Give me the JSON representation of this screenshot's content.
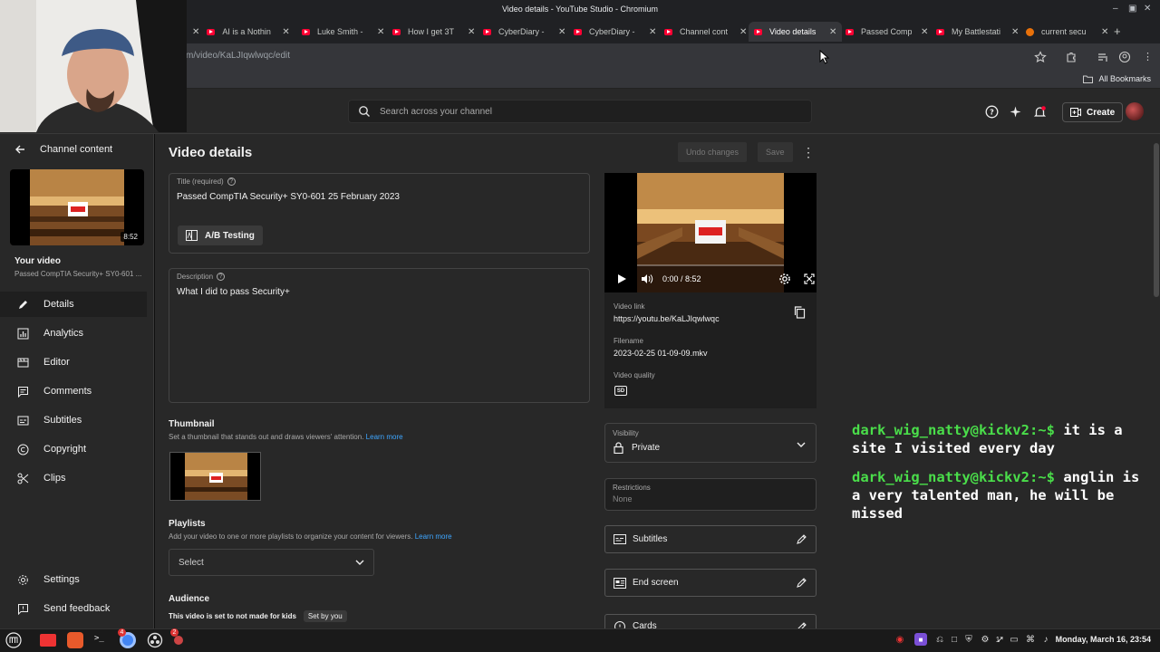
{
  "window": {
    "title": "Video details - YouTube Studio - Chromium",
    "tabs": [
      {
        "label": "AI is a Nothin"
      },
      {
        "label": "Luke Smith -"
      },
      {
        "label": "How I get 3T"
      },
      {
        "label": "CyberDiary -"
      },
      {
        "label": "CyberDiary -"
      },
      {
        "label": "Channel cont"
      },
      {
        "label": "Video details"
      },
      {
        "label": "Passed Comp"
      },
      {
        "label": "My Battlestati"
      },
      {
        "label": "current secu"
      }
    ],
    "url": "m/video/KaLJIqwlwqc/edit",
    "all_bookmarks": "All Bookmarks"
  },
  "header": {
    "search_placeholder": "Search across your channel",
    "create_label": "Create"
  },
  "sidebar": {
    "back_label": "Channel content",
    "thumb_duration": "8:52",
    "your_video": "Your video",
    "your_video_title": "Passed CompTIA Security+ SY0-601 ...",
    "items": [
      {
        "label": "Details",
        "icon": "pencil-icon"
      },
      {
        "label": "Analytics",
        "icon": "analytics-icon"
      },
      {
        "label": "Editor",
        "icon": "editor-icon"
      },
      {
        "label": "Comments",
        "icon": "comments-icon"
      },
      {
        "label": "Subtitles",
        "icon": "subtitles-icon"
      },
      {
        "label": "Copyright",
        "icon": "copyright-icon"
      },
      {
        "label": "Clips",
        "icon": "clips-icon"
      }
    ],
    "settings": "Settings",
    "feedback": "Send feedback"
  },
  "main": {
    "page_title": "Video details",
    "undo_label": "Undo changes",
    "save_label": "Save",
    "title_label": "Title (required)",
    "title_value": "Passed CompTIA Security+ SY0-601 25 February 2023",
    "ab_testing": "A/B Testing",
    "description_label": "Description",
    "description_value": "What I did to pass Security+",
    "thumbnail_title": "Thumbnail",
    "thumbnail_sub": "Set a thumbnail that stands out and draws viewers' attention.",
    "learn_more": "Learn more",
    "playlists_title": "Playlists",
    "playlists_sub": "Add your video to one or more playlists to organize your content for viewers.",
    "playlist_select": "Select",
    "audience_title": "Audience",
    "audience_text": "This video is set to not made for kids",
    "set_by_you": "Set by you"
  },
  "player": {
    "time": "0:00 / 8:52",
    "badge": "Security+",
    "video_link_label": "Video link",
    "video_link": "https://youtu.be/KaLJIqwlwqc",
    "filename_label": "Filename",
    "filename": "2023-02-25 01-09-09.mkv",
    "quality_label": "Video quality",
    "quality_badge": "SD"
  },
  "right": {
    "visibility_label": "Visibility",
    "visibility_value": "Private",
    "restrictions_label": "Restrictions",
    "restrictions_value": "None",
    "subtitles": "Subtitles",
    "end_screen": "End screen",
    "cards": "Cards"
  },
  "chat": [
    {
      "user": "dark_wig_natty@kickv2:~$",
      "message": "it is a site I visited every day"
    },
    {
      "user": "dark_wig_natty@kickv2:~$",
      "message": "anglin is a very talented man, he will be missed"
    }
  ],
  "taskbar": {
    "clock": "Monday, March 16, 23:54",
    "badge_a": "4",
    "badge_b": "2",
    "tray_num": "1"
  },
  "colors": {
    "accent": "#3ea6ff",
    "chat_user": "#4ade4a",
    "brand_red": "#ff0033"
  }
}
